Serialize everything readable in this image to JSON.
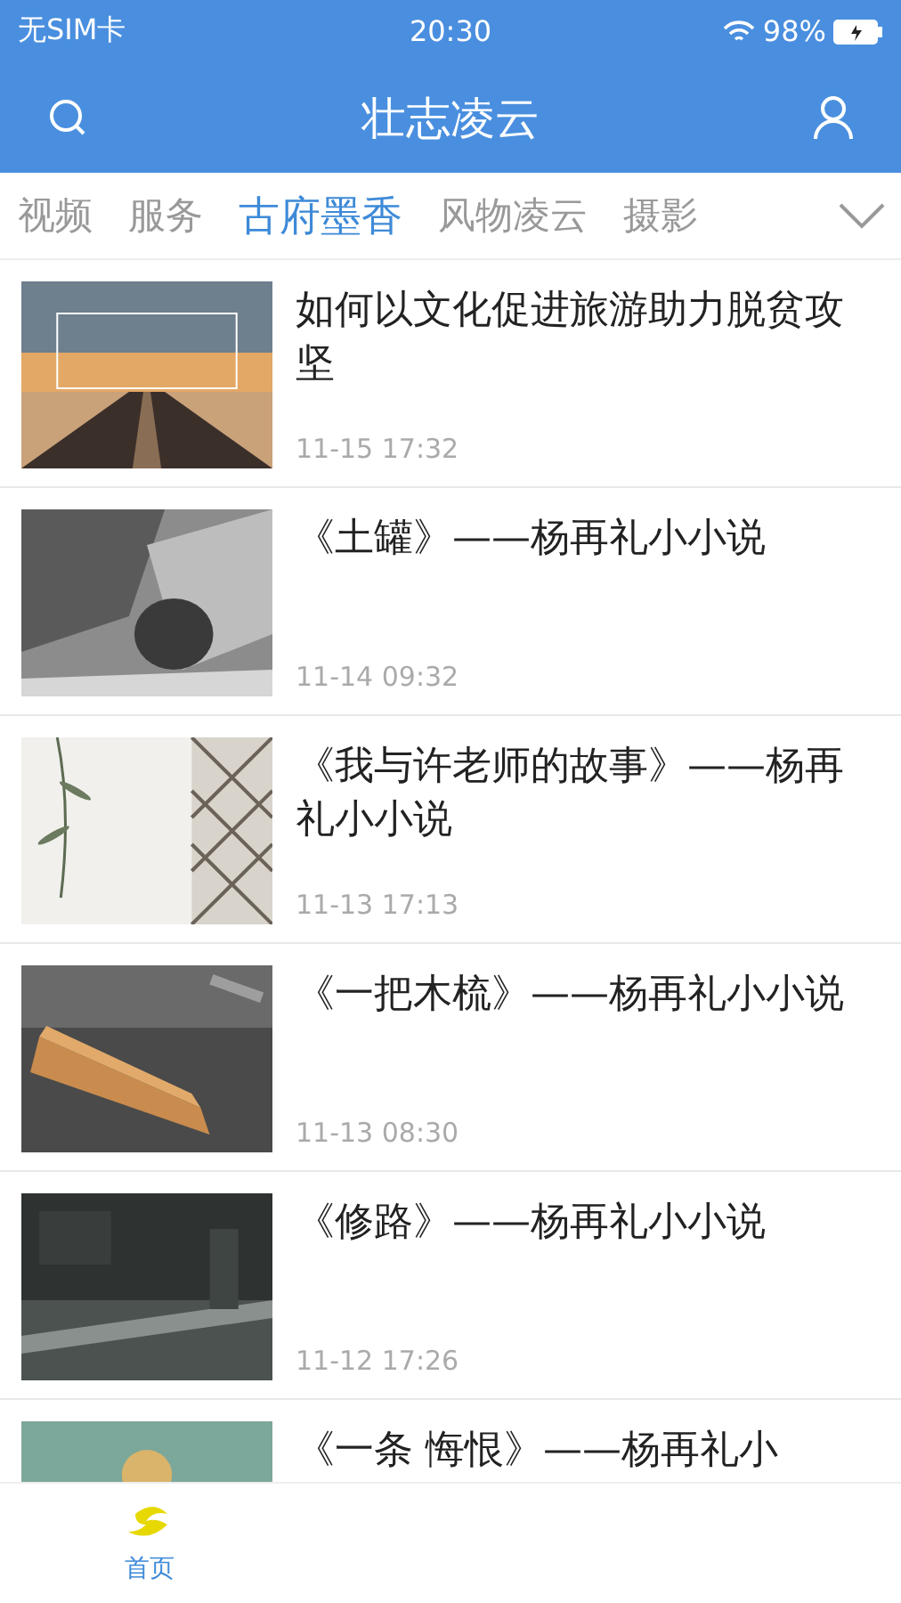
{
  "status_bar": {
    "carrier": "无SIM卡",
    "time": "20:30",
    "battery": "98%"
  },
  "header": {
    "title": "壮志凌云"
  },
  "tabs": [
    {
      "label": "视频",
      "selected": false
    },
    {
      "label": "服务",
      "selected": false
    },
    {
      "label": "古府墨香",
      "selected": true
    },
    {
      "label": "风物凌云",
      "selected": false
    },
    {
      "label": "摄影",
      "selected": false
    }
  ],
  "articles": [
    {
      "title": "如何以文化促进旅游助力脱贫攻坚",
      "time": "11-15 17:32"
    },
    {
      "title": "《土罐》——杨再礼小小说",
      "time": "11-14 09:32"
    },
    {
      "title": "《我与许老师的故事》——杨再礼小小说",
      "time": "11-13 17:13"
    },
    {
      "title": "《一把木梳》——杨再礼小小说",
      "time": "11-13 08:30"
    },
    {
      "title": "《修路》——杨再礼小小说",
      "time": "11-12 17:26"
    },
    {
      "title": "《一条  悔恨》——杨再礼小"
    }
  ],
  "bottom_nav": [
    {
      "label": "首页",
      "selected": true
    }
  ]
}
